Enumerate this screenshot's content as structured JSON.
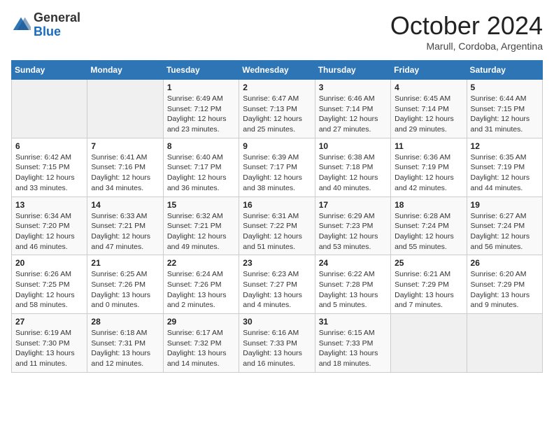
{
  "header": {
    "logo_general": "General",
    "logo_blue": "Blue",
    "month_title": "October 2024",
    "location": "Marull, Cordoba, Argentina"
  },
  "weekdays": [
    "Sunday",
    "Monday",
    "Tuesday",
    "Wednesday",
    "Thursday",
    "Friday",
    "Saturday"
  ],
  "weeks": [
    [
      {
        "day": "",
        "info": ""
      },
      {
        "day": "",
        "info": ""
      },
      {
        "day": "1",
        "info": "Sunrise: 6:49 AM\nSunset: 7:12 PM\nDaylight: 12 hours and 23 minutes."
      },
      {
        "day": "2",
        "info": "Sunrise: 6:47 AM\nSunset: 7:13 PM\nDaylight: 12 hours and 25 minutes."
      },
      {
        "day": "3",
        "info": "Sunrise: 6:46 AM\nSunset: 7:14 PM\nDaylight: 12 hours and 27 minutes."
      },
      {
        "day": "4",
        "info": "Sunrise: 6:45 AM\nSunset: 7:14 PM\nDaylight: 12 hours and 29 minutes."
      },
      {
        "day": "5",
        "info": "Sunrise: 6:44 AM\nSunset: 7:15 PM\nDaylight: 12 hours and 31 minutes."
      }
    ],
    [
      {
        "day": "6",
        "info": "Sunrise: 6:42 AM\nSunset: 7:15 PM\nDaylight: 12 hours and 33 minutes."
      },
      {
        "day": "7",
        "info": "Sunrise: 6:41 AM\nSunset: 7:16 PM\nDaylight: 12 hours and 34 minutes."
      },
      {
        "day": "8",
        "info": "Sunrise: 6:40 AM\nSunset: 7:17 PM\nDaylight: 12 hours and 36 minutes."
      },
      {
        "day": "9",
        "info": "Sunrise: 6:39 AM\nSunset: 7:17 PM\nDaylight: 12 hours and 38 minutes."
      },
      {
        "day": "10",
        "info": "Sunrise: 6:38 AM\nSunset: 7:18 PM\nDaylight: 12 hours and 40 minutes."
      },
      {
        "day": "11",
        "info": "Sunrise: 6:36 AM\nSunset: 7:19 PM\nDaylight: 12 hours and 42 minutes."
      },
      {
        "day": "12",
        "info": "Sunrise: 6:35 AM\nSunset: 7:19 PM\nDaylight: 12 hours and 44 minutes."
      }
    ],
    [
      {
        "day": "13",
        "info": "Sunrise: 6:34 AM\nSunset: 7:20 PM\nDaylight: 12 hours and 46 minutes."
      },
      {
        "day": "14",
        "info": "Sunrise: 6:33 AM\nSunset: 7:21 PM\nDaylight: 12 hours and 47 minutes."
      },
      {
        "day": "15",
        "info": "Sunrise: 6:32 AM\nSunset: 7:21 PM\nDaylight: 12 hours and 49 minutes."
      },
      {
        "day": "16",
        "info": "Sunrise: 6:31 AM\nSunset: 7:22 PM\nDaylight: 12 hours and 51 minutes."
      },
      {
        "day": "17",
        "info": "Sunrise: 6:29 AM\nSunset: 7:23 PM\nDaylight: 12 hours and 53 minutes."
      },
      {
        "day": "18",
        "info": "Sunrise: 6:28 AM\nSunset: 7:24 PM\nDaylight: 12 hours and 55 minutes."
      },
      {
        "day": "19",
        "info": "Sunrise: 6:27 AM\nSunset: 7:24 PM\nDaylight: 12 hours and 56 minutes."
      }
    ],
    [
      {
        "day": "20",
        "info": "Sunrise: 6:26 AM\nSunset: 7:25 PM\nDaylight: 12 hours and 58 minutes."
      },
      {
        "day": "21",
        "info": "Sunrise: 6:25 AM\nSunset: 7:26 PM\nDaylight: 13 hours and 0 minutes."
      },
      {
        "day": "22",
        "info": "Sunrise: 6:24 AM\nSunset: 7:26 PM\nDaylight: 13 hours and 2 minutes."
      },
      {
        "day": "23",
        "info": "Sunrise: 6:23 AM\nSunset: 7:27 PM\nDaylight: 13 hours and 4 minutes."
      },
      {
        "day": "24",
        "info": "Sunrise: 6:22 AM\nSunset: 7:28 PM\nDaylight: 13 hours and 5 minutes."
      },
      {
        "day": "25",
        "info": "Sunrise: 6:21 AM\nSunset: 7:29 PM\nDaylight: 13 hours and 7 minutes."
      },
      {
        "day": "26",
        "info": "Sunrise: 6:20 AM\nSunset: 7:29 PM\nDaylight: 13 hours and 9 minutes."
      }
    ],
    [
      {
        "day": "27",
        "info": "Sunrise: 6:19 AM\nSunset: 7:30 PM\nDaylight: 13 hours and 11 minutes."
      },
      {
        "day": "28",
        "info": "Sunrise: 6:18 AM\nSunset: 7:31 PM\nDaylight: 13 hours and 12 minutes."
      },
      {
        "day": "29",
        "info": "Sunrise: 6:17 AM\nSunset: 7:32 PM\nDaylight: 13 hours and 14 minutes."
      },
      {
        "day": "30",
        "info": "Sunrise: 6:16 AM\nSunset: 7:33 PM\nDaylight: 13 hours and 16 minutes."
      },
      {
        "day": "31",
        "info": "Sunrise: 6:15 AM\nSunset: 7:33 PM\nDaylight: 13 hours and 18 minutes."
      },
      {
        "day": "",
        "info": ""
      },
      {
        "day": "",
        "info": ""
      }
    ]
  ]
}
